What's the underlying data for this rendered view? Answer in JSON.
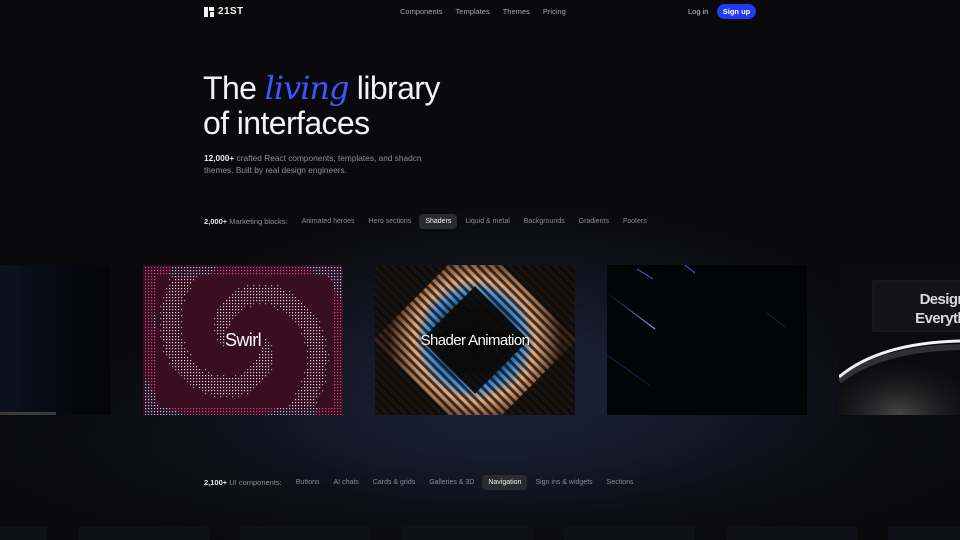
{
  "nav": {
    "brand": "21ST",
    "links": [
      "Components",
      "Templates",
      "Themes",
      "Pricing"
    ],
    "login": "Log in",
    "signup": "Sign up"
  },
  "hero": {
    "title_part1": "The ",
    "title_accent": "living",
    "title_part2": " library",
    "title_line2": "of interfaces",
    "sub_strong": "12,000+",
    "sub_text": " crafted React components, templates, and shadcn themes. Built by real design engineers."
  },
  "marketing": {
    "count": "2,000+",
    "count_label": " Marketing blocks:",
    "chips": [
      "Animated heroes",
      "Hero sections",
      "Shaders",
      "Liquid & metal",
      "Backgrounds",
      "Gradients",
      "Footers"
    ],
    "active_index": 2
  },
  "cards": [
    {
      "label": ""
    },
    {
      "label": "Swirl"
    },
    {
      "label": "Shader Animation"
    },
    {
      "label": ""
    },
    {
      "label": "Design\nEveryth"
    }
  ],
  "ui": {
    "count": "2,100+",
    "count_label": " UI components:",
    "chips": [
      "Buttons",
      "AI chats",
      "Cards & grids",
      "Galleries & 3D",
      "Navigation",
      "Sign ins & widgets",
      "Sections"
    ],
    "active_index": 4
  },
  "colors": {
    "accent": "#3e56ff",
    "signup": "#1f3cf0",
    "background": "#0a0a0c"
  }
}
